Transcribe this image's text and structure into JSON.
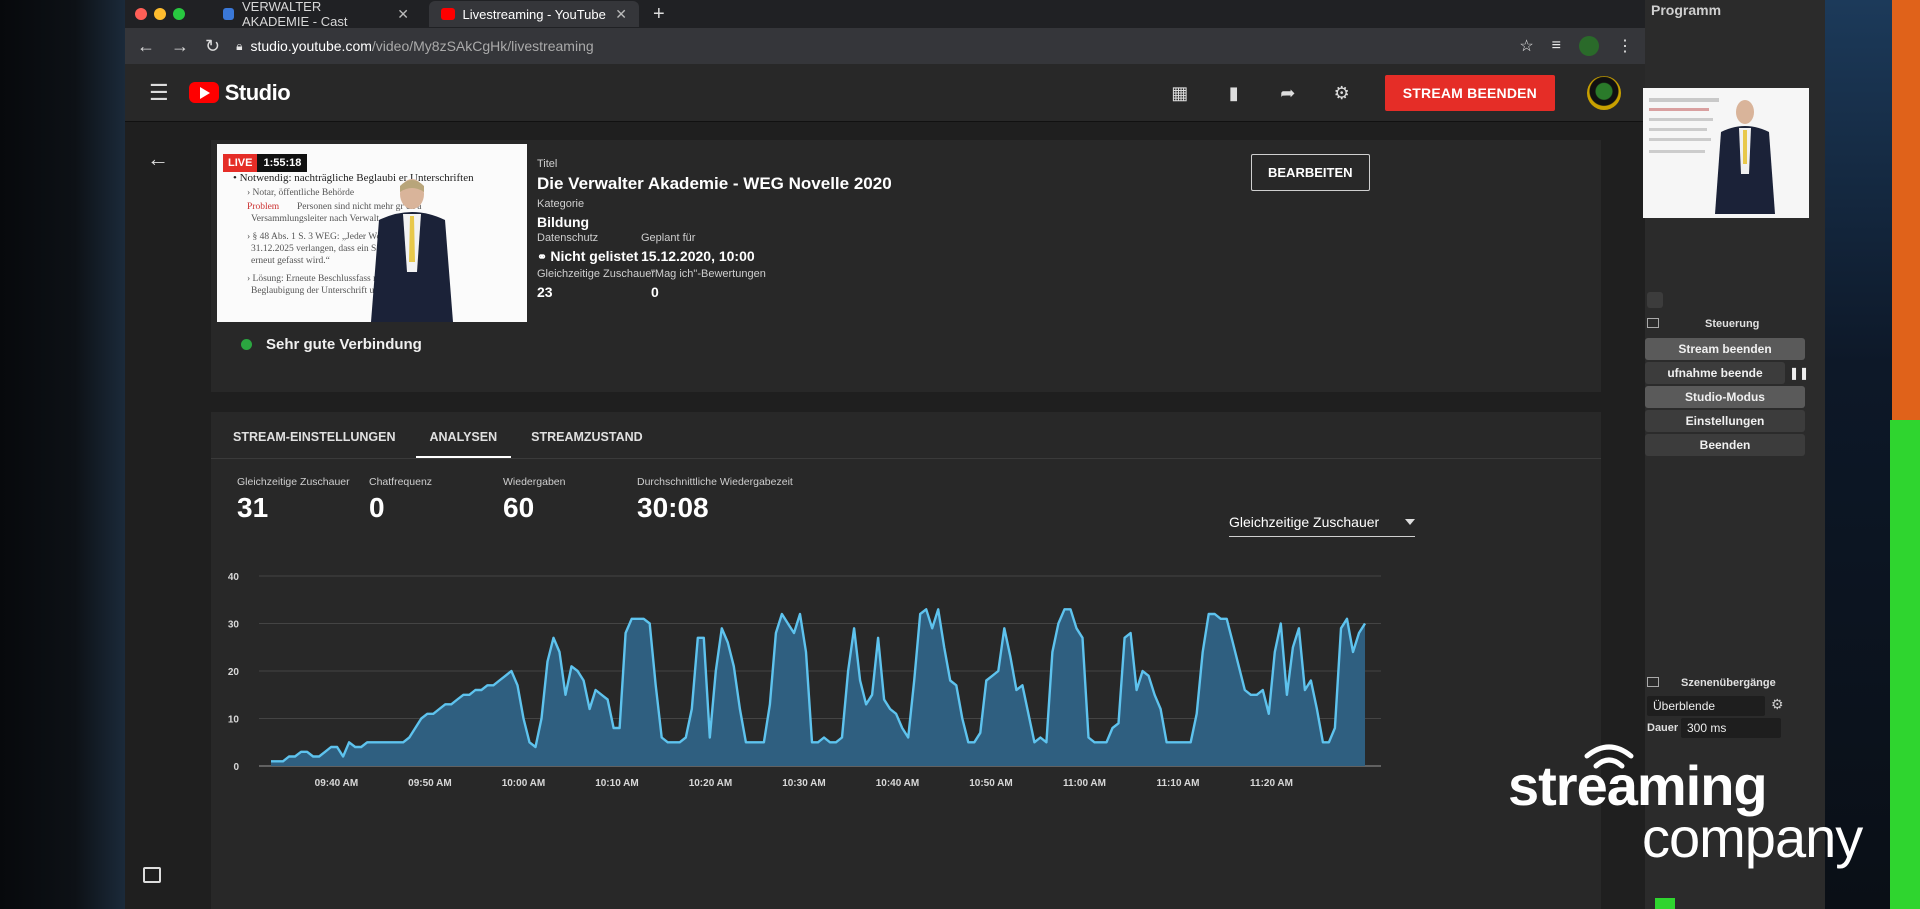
{
  "browser": {
    "tabs": [
      {
        "title": "VERWALTER AKADEMIE - Cast",
        "active": false
      },
      {
        "title": "Livestreaming - YouTube Studio",
        "active": true
      }
    ],
    "url_host": "studio.youtube.com",
    "url_path": "/video/My8zSAkCgHk/livestreaming"
  },
  "header": {
    "logo_text": "Studio",
    "end_stream_label": "STREAM BEENDEN"
  },
  "stream": {
    "live_label": "LIVE",
    "live_time": "1:55:18",
    "connection": "Sehr gute Verbindung",
    "title_label": "Titel",
    "title": "Die Verwalter Akademie - WEG Novelle 2020",
    "category_label": "Kategorie",
    "category": "Bildung",
    "privacy_label": "Datenschutz",
    "privacy": "Nicht gelistet",
    "scheduled_label": "Geplant für",
    "scheduled": "15.12.2020, 10:00",
    "concurrent_label": "Gleichzeitige Zuschauer",
    "concurrent": "23",
    "likes_label": "\"Mag ich\"-Bewertungen",
    "likes": "0",
    "edit_label": "BEARBEITEN"
  },
  "slide": {
    "heading": "• Notwendig: nachträgliche Beglaubi        er Unterschriften",
    "lines": [
      "› Notar, öffentliche Behörde",
      "Problem",
      "Personen sind nicht mehr gr        ch a",
      "Versammlungsleiter nach Verwalt",
      "› § 48 Abs. 1 S. 3 WEG: „Jeder Wo         kann bis zum",
      "31.12.2025 verlangen, dass ein          Satzes 1",
      "erneut gefasst wird.“",
      "› Lösung: Erneute Beschlussfass           ng plus",
      "Beglaubigung der Unterschrift         uge"
    ]
  },
  "analytics": {
    "tabs": [
      "STREAM-EINSTELLUNGEN",
      "ANALYSEN",
      "STREAMZUSTAND"
    ],
    "selected_tab": "ANALYSEN",
    "stats": [
      {
        "label": "Gleichzeitige Zuschauer",
        "value": "31"
      },
      {
        "label": "Chatfrequenz",
        "value": "0"
      },
      {
        "label": "Wiedergaben",
        "value": "60"
      },
      {
        "label": "Durchschnittliche Wiedergabezeit",
        "value": "30:08"
      }
    ],
    "metric_select": "Gleichzeitige Zuschauer"
  },
  "chart_data": {
    "type": "area",
    "ylim": [
      0,
      40
    ],
    "yticks": [
      0,
      10,
      20,
      30,
      40
    ],
    "xticks": [
      "09:40 AM",
      "09:50 AM",
      "10:00 AM",
      "10:10 AM",
      "10:20 AM",
      "10:30 AM",
      "10:40 AM",
      "10:50 AM",
      "11:00 AM",
      "11:10 AM",
      "11:20 AM"
    ],
    "x_start_min": 573,
    "x_end_min": 690,
    "series": [
      {
        "values": [
          1,
          1,
          1,
          2,
          2,
          3,
          3,
          2,
          2,
          3,
          4,
          4,
          2,
          5,
          4,
          4,
          5,
          5,
          5,
          5,
          5,
          5,
          5,
          6,
          8,
          10,
          11,
          11,
          12,
          13,
          13,
          14,
          15,
          15,
          16,
          16,
          17,
          17,
          18,
          19,
          20,
          17,
          10,
          5,
          4,
          10,
          22,
          27,
          24,
          15,
          21,
          20,
          18,
          12,
          16,
          15,
          14,
          8,
          8,
          28,
          31,
          31,
          31,
          30,
          17,
          6,
          5,
          5,
          5,
          6,
          12,
          27,
          27,
          6,
          20,
          29,
          26,
          21,
          12,
          5,
          5,
          5,
          5,
          13,
          28,
          32,
          30,
          28,
          32,
          24,
          5,
          5,
          6,
          5,
          5,
          6,
          20,
          29,
          18,
          13,
          15,
          27,
          14,
          12,
          11,
          8,
          6,
          18,
          32,
          33,
          29,
          33,
          25,
          18,
          17,
          10,
          5,
          5,
          7,
          18,
          19,
          20,
          29,
          23,
          16,
          17,
          11,
          5,
          6,
          5,
          24,
          30,
          33,
          33,
          29,
          27,
          6,
          5,
          5,
          5,
          8,
          9,
          27,
          28,
          16,
          20,
          19,
          15,
          12,
          5,
          5,
          5,
          5,
          5,
          11,
          24,
          32,
          32,
          31,
          31,
          26,
          21,
          16,
          15,
          15,
          16,
          11,
          24,
          30,
          15,
          25,
          29,
          16,
          18,
          12,
          5,
          5,
          8,
          29,
          31,
          24,
          28,
          30
        ]
      }
    ]
  },
  "obs": {
    "program_title": "Programm",
    "controls_title": "Steuerung",
    "buttons": [
      "Stream beenden",
      "ufnahme beende",
      "Studio-Modus",
      "Einstellungen",
      "Beenden"
    ],
    "transitions_title": "Szenenübergänge",
    "transition": "Überblende",
    "duration_label": "Dauer",
    "duration": "300 ms"
  },
  "watermark": {
    "line1": "streaming",
    "line2": "company"
  },
  "colors": {
    "accent_red": "#e52d27",
    "chart_line": "#5ec3ee",
    "chart_fill": "#2f5f80",
    "status_green": "#2ba640"
  }
}
